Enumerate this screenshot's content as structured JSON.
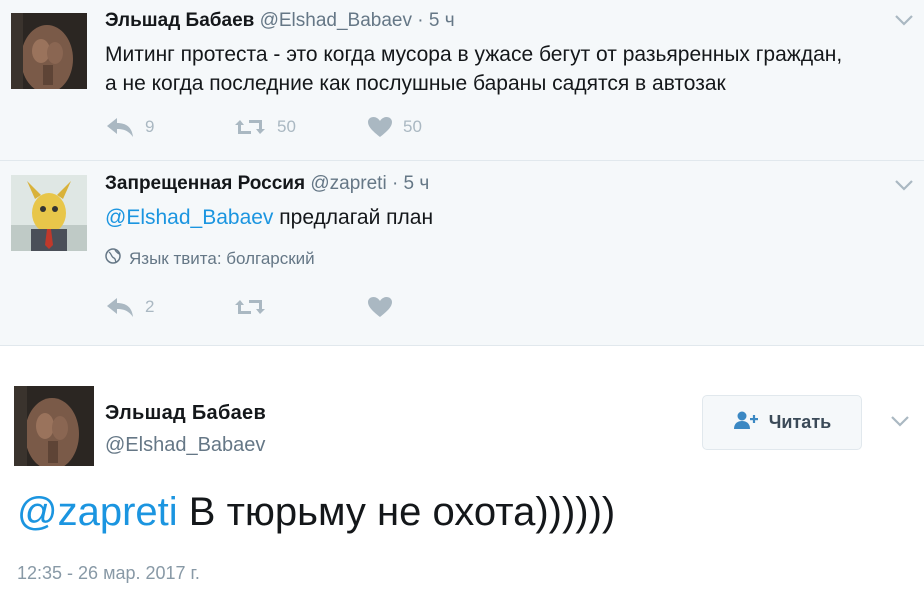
{
  "tweets": [
    {
      "name": "Эльшад Бабаев",
      "handle": "@Elshad_Babaev",
      "time": "· 5 ч",
      "text_line1": "Митинг протеста - это когда мусора в ужасе бегут от разьяренных граждан,",
      "text_line2": "а не когда последние как послушные бараны садятся в автозак",
      "reply_count": "9",
      "retweet_count": "50",
      "like_count": "50"
    },
    {
      "name": "Запрещенная Россия",
      "handle": "@zapreti",
      "time": "· 5 ч",
      "mention": "@Elshad_Babaev",
      "text": " предлагай план",
      "language_note": "Язык твита: болгарский",
      "reply_count": "2"
    }
  ],
  "main_tweet": {
    "name": "Эльшад Бабаев",
    "handle": "@Elshad_Babaev",
    "follow_label": "Читать",
    "mention": "@zapreti",
    "text": " В тюрьму не охота))))))",
    "timestamp": "12:35 - 26 мар. 2017 г."
  },
  "colors": {
    "link": "#1b95e0",
    "muted": "#657786",
    "icon": "#aab8c2",
    "thread_bg": "#f5f8fa"
  },
  "icons": [
    "reply-icon",
    "retweet-icon",
    "like-icon",
    "globe-icon",
    "follow-person-icon",
    "chevron-down-icon"
  ]
}
